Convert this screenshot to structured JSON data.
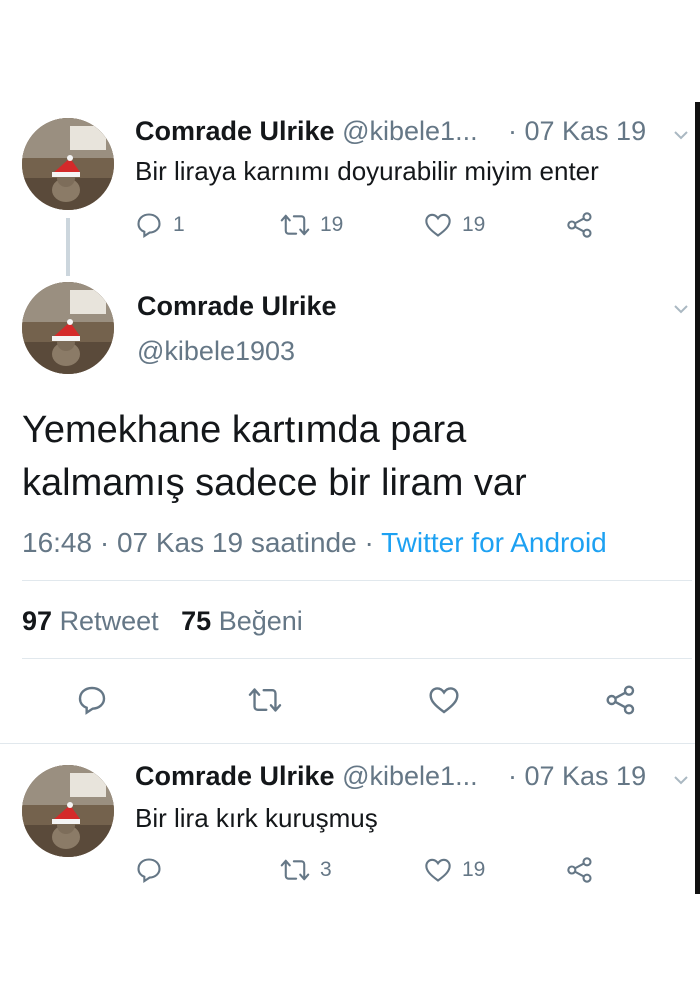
{
  "author": {
    "name": "Comrade Ulrike",
    "handle_truncated": "@kibele1...",
    "handle": "@kibele1903"
  },
  "tweets": [
    {
      "date": "· 07 Kas 19",
      "text": "Bir liraya karnımı doyurabilir miyim enter",
      "replies": "1",
      "retweets": "19",
      "likes": "19"
    },
    {
      "date": "· 07 Kas 19",
      "text": "Bir lira kırk kuruşmuş",
      "replies": "",
      "retweets": "3",
      "likes": "19"
    }
  ],
  "main_tweet": {
    "text_line1": "Yemekhane kartımda para",
    "text_line2": "kalmamış sadece bir liram var",
    "time": "16:48 · 07 Kas 19 saatinde ·",
    "client": "Twitter for Android",
    "retweet_count": "97",
    "retweet_label": "Retweet",
    "like_count": "75",
    "like_label": "Beğeni"
  },
  "icons": {
    "reply": "reply-icon",
    "retweet": "retweet-icon",
    "like": "heart-icon",
    "share": "share-icon",
    "more": "chevron-down-icon"
  },
  "colors": {
    "link": "#1da1f2",
    "muted": "#657786",
    "divider": "#e1e8ed"
  }
}
